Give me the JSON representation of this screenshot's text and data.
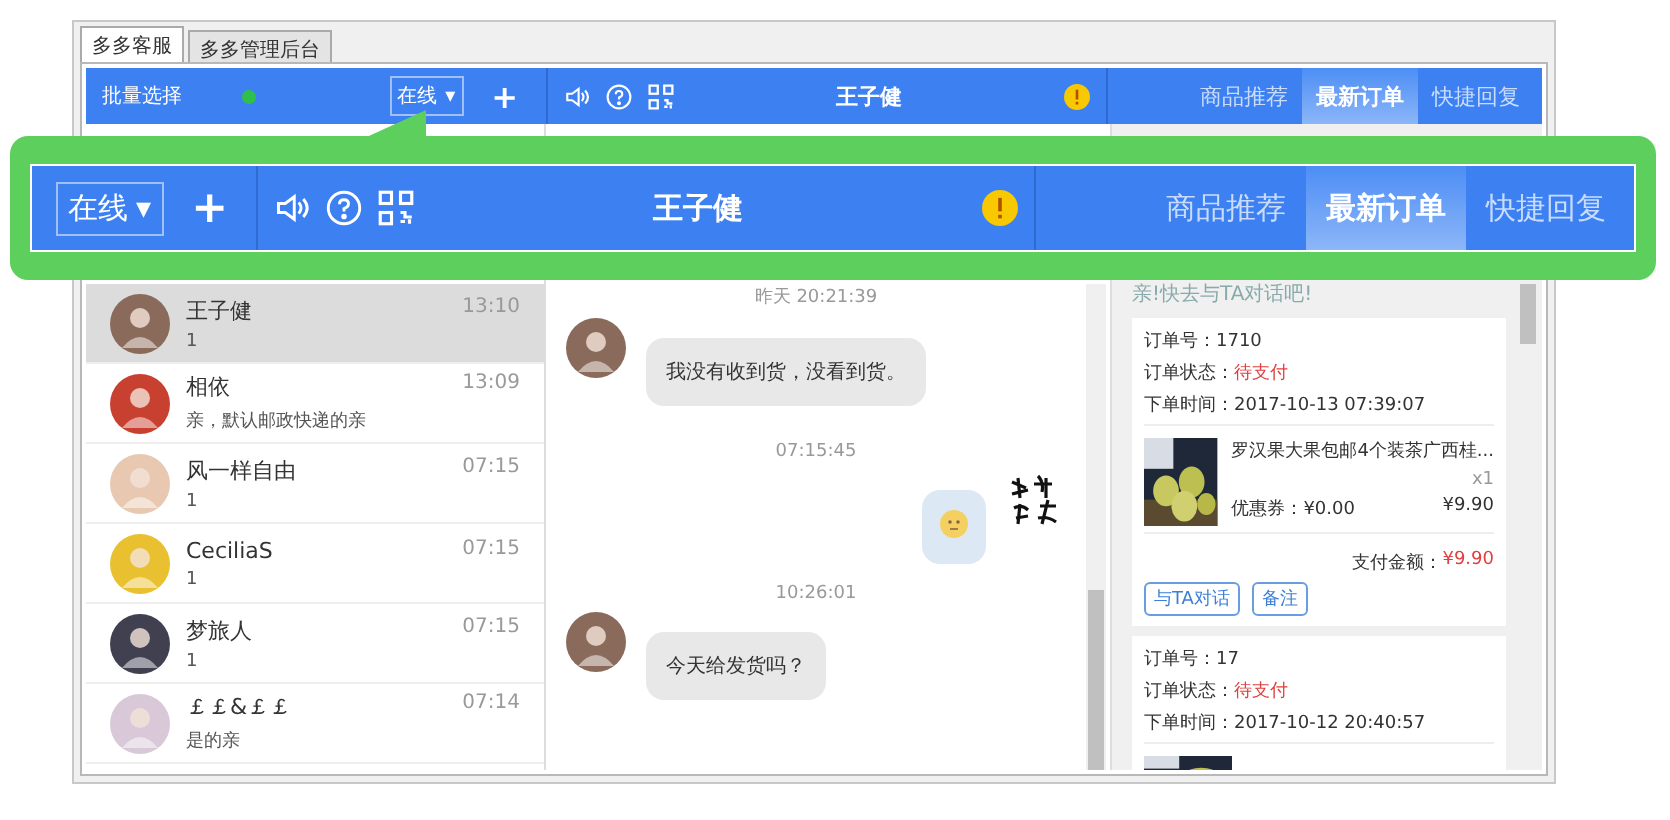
{
  "app_tabs": [
    {
      "label": "多多客服",
      "selected": true
    },
    {
      "label": "多多管理后台",
      "selected": false
    }
  ],
  "toolbar": {
    "batch_select": "批量选择",
    "status": "在线",
    "status_caret": "▾",
    "add": "+",
    "contact": "王子健",
    "panel_tabs": [
      {
        "label": "商品推荐",
        "selected": false
      },
      {
        "label": "最新订单",
        "selected": true
      },
      {
        "label": "快捷回复",
        "selected": false
      }
    ]
  },
  "magnified_toolbar": {
    "status": "在线",
    "status_caret": "▾",
    "add": "+",
    "contact": "王子健",
    "panel_tabs": [
      {
        "label": "商品推荐",
        "selected": false
      },
      {
        "label": "最新订单",
        "selected": true
      },
      {
        "label": "快捷回复",
        "selected": false
      }
    ]
  },
  "conversations": [
    {
      "name": "王子健",
      "preview": "1",
      "time": "13:10",
      "selected": true
    },
    {
      "name": "相依",
      "preview": "亲，默认邮政快递的亲",
      "time": "13:09",
      "selected": false
    },
    {
      "name": "风一样自由",
      "preview": "1",
      "time": "07:15",
      "selected": false
    },
    {
      "name": "CeciliaS",
      "preview": "1",
      "time": "07:15",
      "selected": false
    },
    {
      "name": "梦旅人",
      "preview": "1",
      "time": "07:15",
      "selected": false
    },
    {
      "name": "￡￡&￡￡",
      "preview": "是的亲",
      "time": "07:14",
      "selected": false
    }
  ],
  "messages": [
    {
      "time": "昨天 20:21:39",
      "outgoing": false,
      "kind": "text",
      "text": "我没有收到货，没看到货。"
    },
    {
      "time": "07:15:45",
      "outgoing": true,
      "kind": "emoji"
    },
    {
      "time": "10:26:01",
      "outgoing": false,
      "kind": "text",
      "text": "今天给发货吗？"
    }
  ],
  "order_panel": {
    "hint": "亲!快去与TA对话吧!",
    "orders": [
      {
        "number_label": "订单号：",
        "number": "1710",
        "status_label": "订单状态：",
        "status": "待支付",
        "time_label": "下单时间：",
        "time": "2017-10-13 07:39:07",
        "product": "罗汉果大果包邮4个装茶广西桂...",
        "quantity": "x1",
        "coupon": "优惠券：¥0.00",
        "price": "¥9.90",
        "pay_label": "支付金额：",
        "pay": "¥9.90",
        "buttons": [
          "与TA对话",
          "备注"
        ]
      },
      {
        "number_label": "订单号：",
        "number": "17",
        "status_label": "订单状态：",
        "status": "待支付",
        "time_label": "下单时间：",
        "time": "2017-10-12 20:40:57"
      }
    ]
  }
}
